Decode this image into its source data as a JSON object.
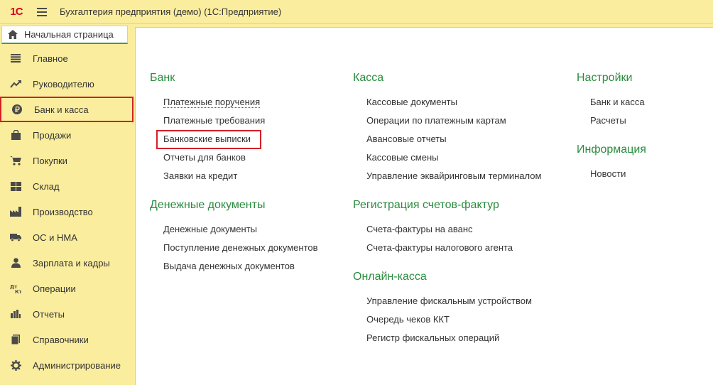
{
  "app": {
    "logo": "1С",
    "title": "Бухгалтерия предприятия (демо)  (1С:Предприятие)"
  },
  "home_tab": {
    "label": "Начальная страница"
  },
  "sidebar": {
    "items": [
      {
        "label": "Главное",
        "icon": "list-icon"
      },
      {
        "label": "Руководителю",
        "icon": "trend-icon"
      },
      {
        "label": "Банк и касса",
        "icon": "ruble-icon",
        "active": true
      },
      {
        "label": "Продажи",
        "icon": "shopping-bag-icon"
      },
      {
        "label": "Покупки",
        "icon": "cart-icon"
      },
      {
        "label": "Склад",
        "icon": "warehouse-grid-icon"
      },
      {
        "label": "Производство",
        "icon": "factory-icon"
      },
      {
        "label": "ОС и НМА",
        "icon": "truck-icon"
      },
      {
        "label": "Зарплата и кадры",
        "icon": "person-icon"
      },
      {
        "label": "Операции",
        "icon": "debit-credit-icon"
      },
      {
        "label": "Отчеты",
        "icon": "bar-chart-icon"
      },
      {
        "label": "Справочники",
        "icon": "book-icon"
      },
      {
        "label": "Администрирование",
        "icon": "gear-icon"
      }
    ]
  },
  "sections": {
    "bank": {
      "title": "Банк",
      "links": [
        "Платежные поручения",
        "Платежные требования",
        "Банковские выписки",
        "Отчеты для банков",
        "Заявки на кредит"
      ]
    },
    "money_docs": {
      "title": "Денежные документы",
      "links": [
        "Денежные документы",
        "Поступление денежных документов",
        "Выдача денежных документов"
      ]
    },
    "cash": {
      "title": "Касса",
      "links": [
        "Кассовые документы",
        "Операции по платежным картам",
        "Авансовые отчеты",
        "Кассовые смены",
        "Управление эквайринговым терминалом"
      ]
    },
    "invoices": {
      "title": "Регистрация счетов-фактур",
      "links": [
        "Счета-фактуры на аванс",
        "Счета-фактуры налогового агента"
      ]
    },
    "online_cash": {
      "title": "Онлайн-касса",
      "links": [
        "Управление фискальным устройством",
        "Очередь чеков ККТ",
        "Регистр фискальных операций"
      ]
    },
    "settings": {
      "title": "Настройки",
      "links": [
        "Банк и касса",
        "Расчеты"
      ]
    },
    "info": {
      "title": "Информация",
      "links": [
        "Новости"
      ]
    }
  },
  "colors": {
    "sidebar_bg": "#fbed9e",
    "section_title": "#2a8c3e",
    "highlight": "#d32027"
  }
}
